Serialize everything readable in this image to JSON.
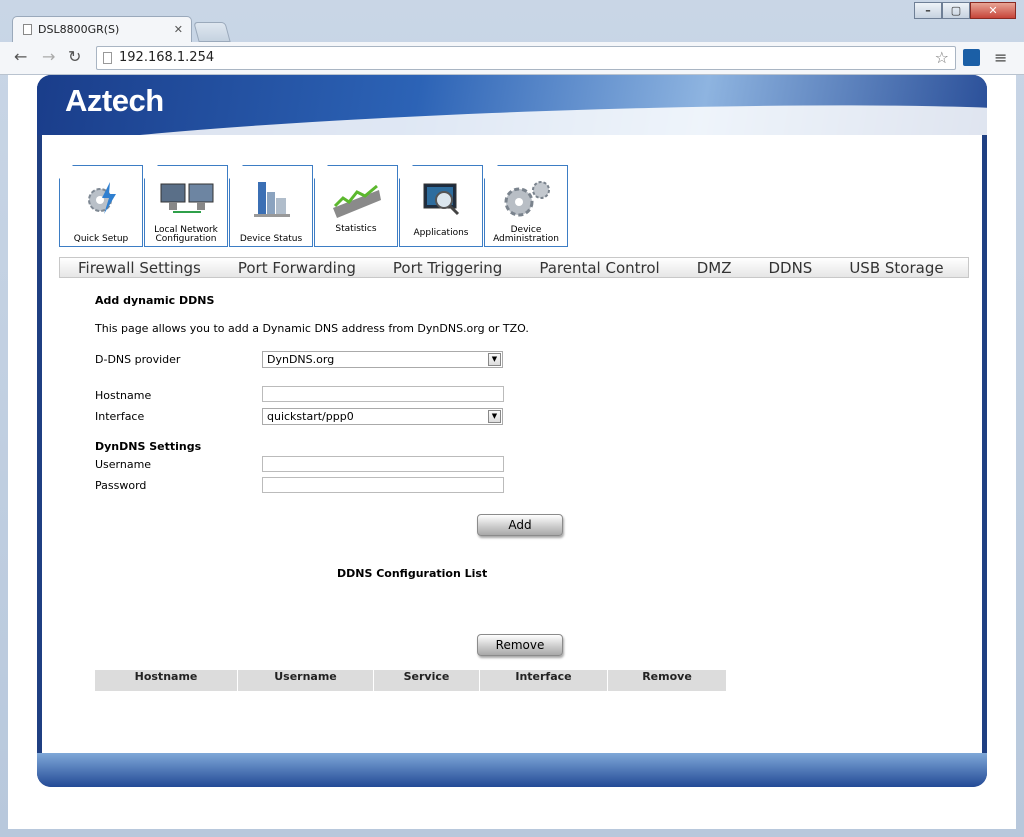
{
  "browser": {
    "tab_title": "DSL8800GR(S)",
    "url": "192.168.1.254",
    "controls": [
      "minimize-icon",
      "maximize-icon",
      "close-icon"
    ]
  },
  "brand": {
    "logo": "Aztech"
  },
  "icon_tabs": [
    {
      "label": "Quick Setup",
      "icon": "gear-lightning-icon"
    },
    {
      "label": "Local Network Configuration",
      "icon": "monitors-icon"
    },
    {
      "label": "Device Status",
      "icon": "buildings-icon"
    },
    {
      "label": "Statistics",
      "icon": "line-graph-icon"
    },
    {
      "label": "Applications",
      "icon": "screen-magnifier-icon"
    },
    {
      "label": "Device Administration",
      "icon": "gears-icon"
    }
  ],
  "subnav": [
    "Firewall Settings",
    "Port Forwarding",
    "Port Triggering",
    "Parental Control",
    "DMZ",
    "DDNS",
    "USB Storage"
  ],
  "form": {
    "title": "Add dynamic DDNS",
    "description": "This page allows you to add a Dynamic DNS address from DynDNS.org or TZO.",
    "provider_label": "D-DNS provider",
    "provider_value": "DynDNS.org",
    "hostname_label": "Hostname",
    "hostname_value": "",
    "interface_label": "Interface",
    "interface_value": "quickstart/ppp0",
    "settings_heading": "DynDNS Settings",
    "username_label": "Username",
    "username_value": "",
    "password_label": "Password",
    "password_value": "",
    "add_button": "Add"
  },
  "list": {
    "title": "DDNS Configuration List",
    "columns": [
      "Hostname",
      "Username",
      "Service",
      "Interface",
      "Remove"
    ],
    "rows": [],
    "remove_button": "Remove"
  },
  "colors": {
    "frame": "#1f3f82",
    "tab_border": "#3d7dc4",
    "table_header": "#dcdcdc"
  }
}
